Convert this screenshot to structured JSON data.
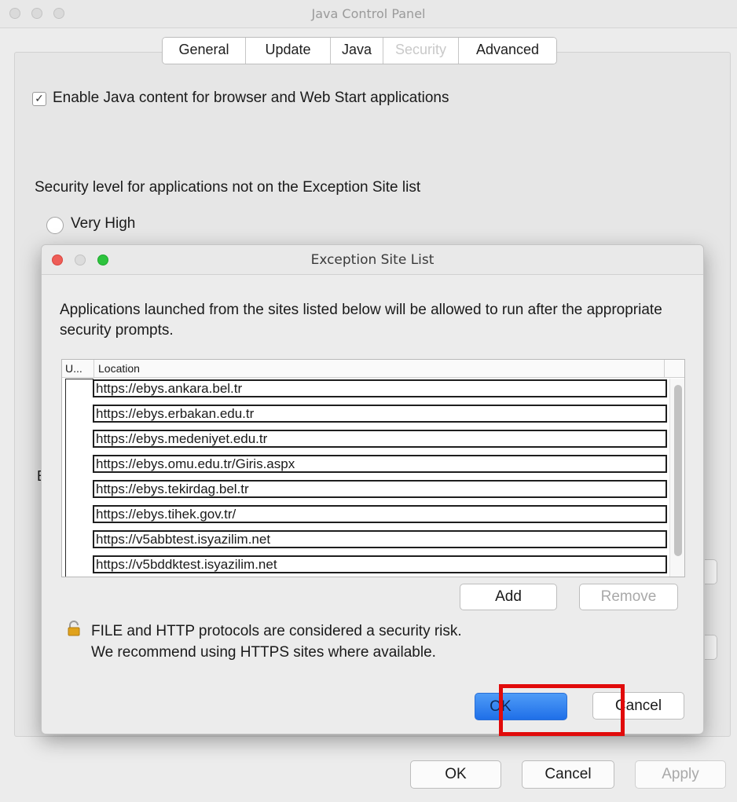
{
  "main_window": {
    "title": "Java Control Panel",
    "tabs": [
      {
        "label": "General"
      },
      {
        "label": "Update"
      },
      {
        "label": "Java"
      },
      {
        "label": "Security"
      },
      {
        "label": "Advanced"
      }
    ],
    "active_tab": "Security",
    "enable_java_label": "Enable Java content for browser and Web Start applications",
    "enable_java_checked": true,
    "security_level_label": "Security level for applications not on the Exception Site list",
    "very_high_label": "Very High",
    "partially_hidden_label": "E",
    "buttons": {
      "ok": "OK",
      "cancel": "Cancel",
      "apply": "Apply"
    }
  },
  "dialog": {
    "title": "Exception Site List",
    "description": "Applications launched from the sites listed below will be allowed to run after the appropriate security prompts.",
    "table": {
      "columns": [
        "U...",
        "Location"
      ],
      "rows": [
        "https://ebys.ankara.bel.tr",
        "https://ebys.erbakan.edu.tr",
        "https://ebys.medeniyet.edu.tr",
        "https://ebys.omu.edu.tr/Giris.aspx",
        "https://ebys.tekirdag.bel.tr",
        "https://ebys.tihek.gov.tr/",
        "https://v5abbtest.isyazilim.net",
        "https://v5bddktest.isyazilim.net"
      ]
    },
    "add_label": "Add",
    "remove_label": "Remove",
    "warning_line1": "FILE and HTTP protocols are considered a security risk.",
    "warning_line2": "We recommend using HTTPS sites where available.",
    "ok_label": "OK",
    "cancel_label": "Cancel"
  },
  "colors": {
    "highlight": "#e10b0b",
    "primary_button": "#1f6fe8",
    "close_dot": "#ee5d57",
    "maximize_dot": "#2dc33d"
  },
  "icons": {
    "warning": "padlock-icon"
  }
}
